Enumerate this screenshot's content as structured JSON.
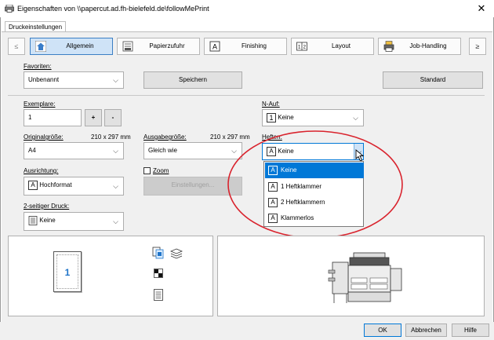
{
  "window": {
    "title": "Eigenschaften von \\\\papercut.ad.fh-bielefeld.de\\followMePrint",
    "close": "✕"
  },
  "tabs": [
    {
      "label": "Druckeinstellungen"
    }
  ],
  "nav": {
    "prev": "≤",
    "next": "≥",
    "items": [
      {
        "label": "Allgemein",
        "icon": "house-icon"
      },
      {
        "label": "Papierzufuhr",
        "icon": "paper-tray-icon"
      },
      {
        "label": "Finishing",
        "icon": "finishing-icon"
      },
      {
        "label": "Layout",
        "icon": "layout-icon"
      },
      {
        "label": "Job-Handling",
        "icon": "job-handling-icon"
      }
    ]
  },
  "favorites": {
    "label": "Favoriten:",
    "value": "Unbenannt",
    "save_button": "Speichern",
    "default_button": "Standard"
  },
  "copies": {
    "label": "Exemplare:",
    "value": "1",
    "plus": "+",
    "minus": "-"
  },
  "original_size": {
    "label": "Originalgröße:",
    "dimensions": "210 x 297 mm",
    "value": "A4"
  },
  "output_size": {
    "label": "Ausgabegröße:",
    "dimensions": "210 x 297 mm",
    "value": "Gleich wie"
  },
  "orientation": {
    "label": "Ausrichtung:",
    "value": "Hochformat"
  },
  "zoom": {
    "label": "Zoom",
    "settings_button": "Einstellungen..."
  },
  "duplex": {
    "label": "2-seitiger Druck:",
    "value": "Keine"
  },
  "n_up": {
    "label": "N-Auf:",
    "value": "Keine",
    "icon_text": "1"
  },
  "stapling": {
    "label": "Heften:",
    "value": "Keine",
    "options": [
      {
        "label": "Keine",
        "selected": true
      },
      {
        "label": "1 Heftklammer",
        "selected": false
      },
      {
        "label": "2 Heftklammern",
        "selected": false
      },
      {
        "label": "Klammerlos",
        "selected": false
      }
    ]
  },
  "preview": {
    "page_number": "1"
  },
  "footer": {
    "ok": "OK",
    "cancel": "Abbrechen",
    "help": "Hilfe"
  },
  "colors": {
    "accent": "#0078d7",
    "annotation": "#d9232d",
    "active_tab": "#cfe3f7"
  }
}
